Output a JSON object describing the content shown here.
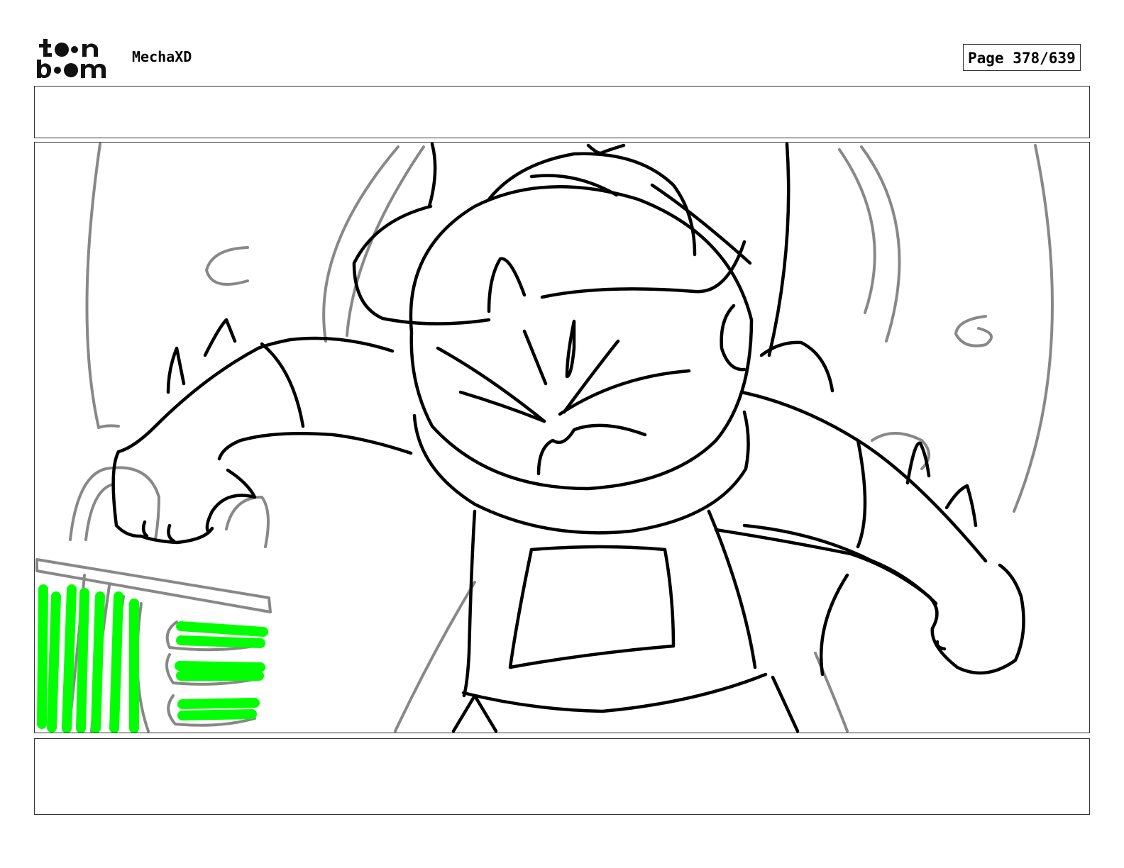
{
  "header": {
    "logo_text": "toon boom",
    "project_name": "MechaXD",
    "page_label": "Page 378/639"
  },
  "panel": {
    "action_notes": "",
    "dialogue_notes": ""
  },
  "colors": {
    "sketch_line": "#000000",
    "rough_line": "#888888",
    "accent_green": "#00ff00",
    "frame_border": "#333333"
  }
}
